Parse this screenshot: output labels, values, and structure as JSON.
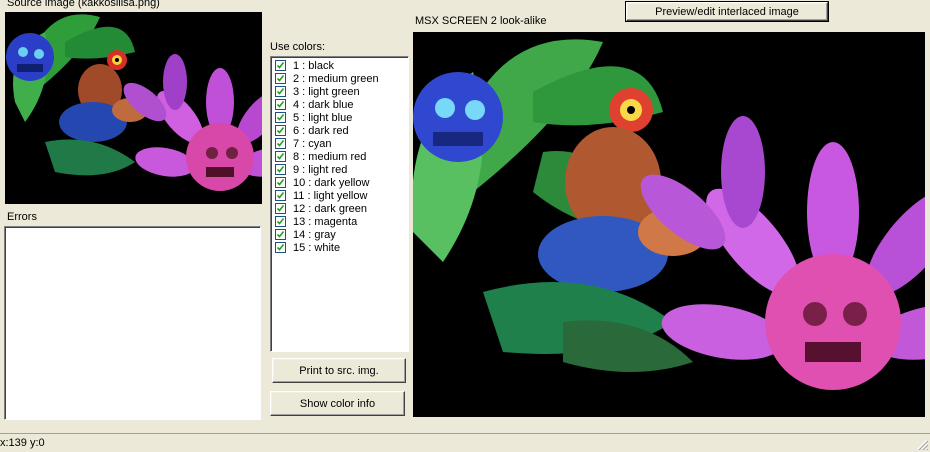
{
  "source_panel": {
    "title": "Source image (kakkosliisa.png)"
  },
  "errors_panel": {
    "title": "Errors",
    "content": ""
  },
  "colors_panel": {
    "title": "Use colors:",
    "items": [
      {
        "label": "1 : black",
        "checked": true
      },
      {
        "label": "2 : medium green",
        "checked": true
      },
      {
        "label": "3 : light green",
        "checked": true
      },
      {
        "label": "4 : dark blue",
        "checked": true
      },
      {
        "label": "5 : light blue",
        "checked": true
      },
      {
        "label": "6 : dark red",
        "checked": true
      },
      {
        "label": "7 : cyan",
        "checked": true
      },
      {
        "label": "8 : medium red",
        "checked": true
      },
      {
        "label": "9 : light red",
        "checked": true
      },
      {
        "label": "10 : dark yellow",
        "checked": true
      },
      {
        "label": "11 : light yellow",
        "checked": true
      },
      {
        "label": "12 : dark green",
        "checked": true
      },
      {
        "label": "13 : magenta",
        "checked": true
      },
      {
        "label": "14 : gray",
        "checked": true
      },
      {
        "label": "15 : white",
        "checked": true
      }
    ]
  },
  "buttons": {
    "print": "Print to src. img.",
    "color_info": "Show color info",
    "preview": "Preview/edit interlaced image"
  },
  "preview_panel": {
    "title": "MSX SCREEN 2 look-alike"
  },
  "status": {
    "coords": "x:139 y:0"
  },
  "colors": {
    "window_bg": "#ece9d8",
    "image_bg": "#000000"
  }
}
